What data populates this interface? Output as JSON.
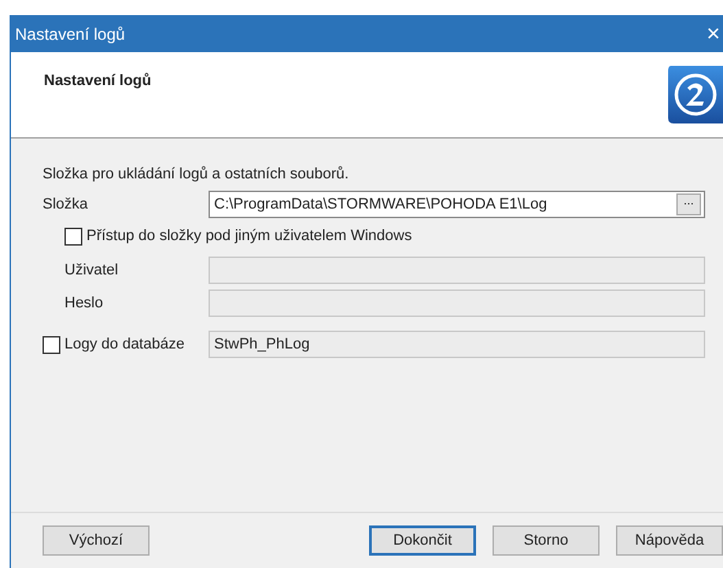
{
  "window": {
    "title": "Nastavení logů",
    "close": "×"
  },
  "header": {
    "title": "Nastavení logů"
  },
  "intro": "Složka pro ukládání logů a ostatních souborů.",
  "rows": [
    {
      "kind": "field",
      "label": "Složka",
      "value": "C:\\ProgramData\\STORMWARE\\POHODA E1\\Log",
      "disabled": false,
      "browse": "..."
    },
    {
      "kind": "checkbox",
      "label": "Přístup do složky pod jiným uživatelem Windows",
      "checked": false
    },
    {
      "kind": "field",
      "label": "Uživatel",
      "disabled": true,
      "indent": true
    },
    {
      "kind": "field",
      "label": "Heslo",
      "disabled": true,
      "indent": true
    },
    {
      "kind": "checkfield",
      "label": "Logy do databáze",
      "checked": false,
      "value": "StwPh_PhLog",
      "disabled": true
    }
  ],
  "left_buttons": [
    {
      "label": "Výchozí",
      "default": false
    }
  ],
  "right_buttons": [
    {
      "label": "Dokončit",
      "default": true
    },
    {
      "label": "Storno",
      "default": false
    },
    {
      "label": "Nápověda",
      "default": false
    }
  ]
}
